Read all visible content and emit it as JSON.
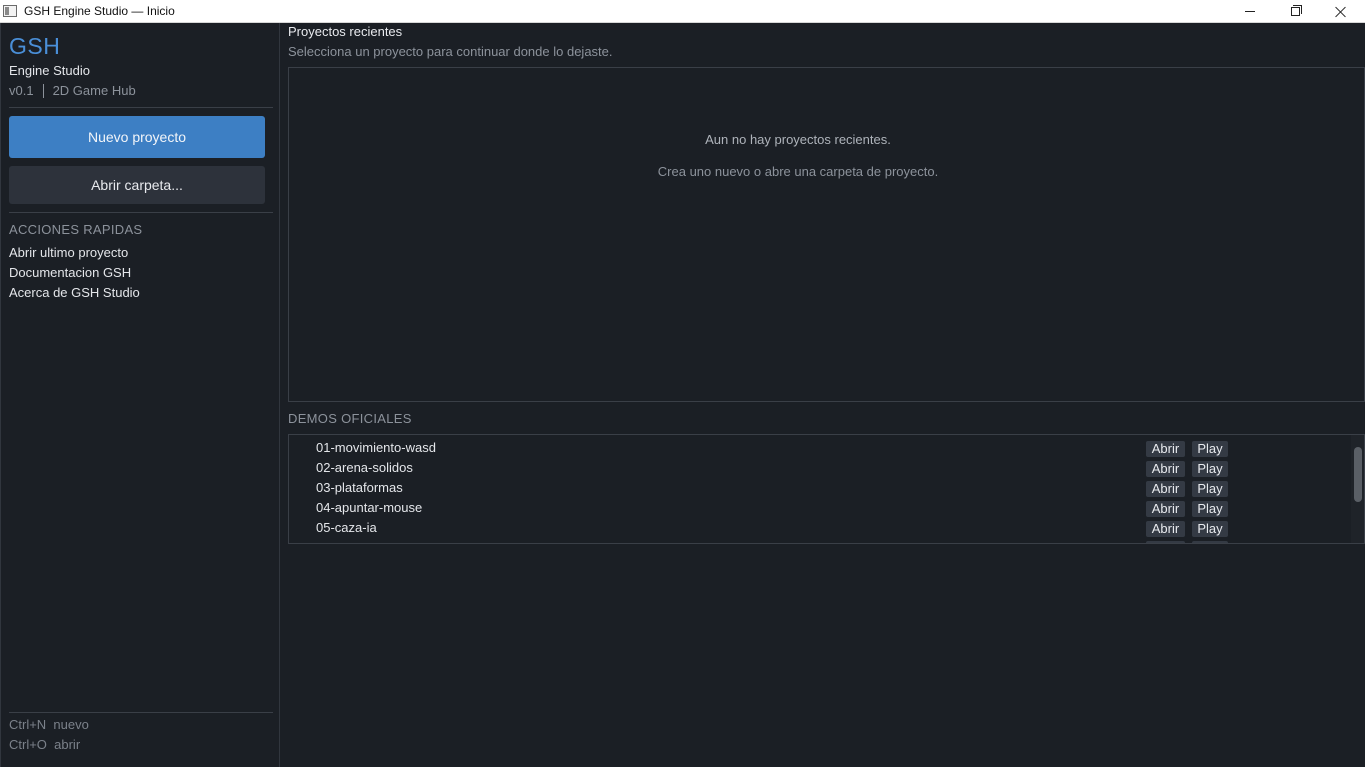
{
  "window": {
    "title": "GSH Engine Studio — Inicio"
  },
  "sidebar": {
    "brand": "GSH",
    "subtitle": "Engine Studio",
    "version": "v0.1",
    "tagline": "2D Game Hub",
    "new_project_label": "Nuevo proyecto",
    "open_folder_label": "Abrir carpeta...",
    "quick_actions_label": "ACCIONES RAPIDAS",
    "quick_actions": [
      "Abrir ultimo proyecto",
      "Documentacion GSH",
      "Acerca de GSH Studio"
    ],
    "shortcuts": [
      "Ctrl+N  nuevo",
      "Ctrl+O  abrir"
    ]
  },
  "main": {
    "recent_title": "Proyectos recientes",
    "recent_subtitle": "Selecciona un proyecto para continuar donde lo dejaste.",
    "empty_message": "Aun no hay proyectos recientes.",
    "empty_hint": "Crea uno nuevo o abre una carpeta de proyecto.",
    "demos_label": "DEMOS OFICIALES",
    "open_label": "Abrir",
    "play_label": "Play",
    "demos": [
      "01-movimiento-wasd",
      "02-arena-solidos",
      "03-plataformas",
      "04-apuntar-mouse",
      "05-caza-ia"
    ]
  },
  "colors": {
    "accent": "#3d7fc4",
    "brand": "#4a8fd8",
    "background": "#1b1f25"
  }
}
